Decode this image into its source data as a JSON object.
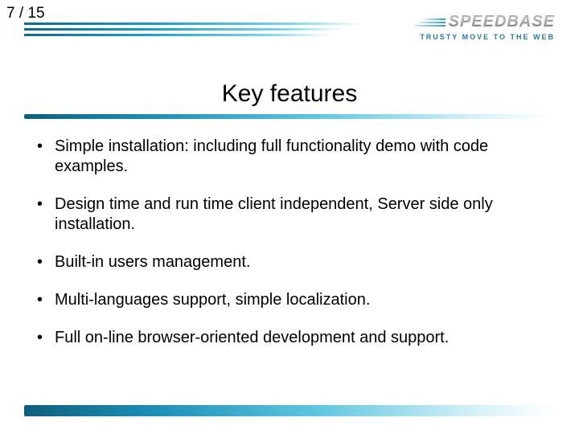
{
  "page": {
    "current": 7,
    "total": 15,
    "label": "7 / 15"
  },
  "logo": {
    "name": "SPEEDBASE",
    "tagline": "TRUSTY MOVE TO THE WEB"
  },
  "title": "Key features",
  "bullets": [
    "Simple installation: including full functionality demo with code examples.",
    "Design time and run time client independent, Server side only installation.",
    "Built-in users management.",
    "Multi-languages support, simple localization.",
    "Full on-line browser-oriented development and support."
  ],
  "colors": {
    "accent": "#1c90b8"
  }
}
